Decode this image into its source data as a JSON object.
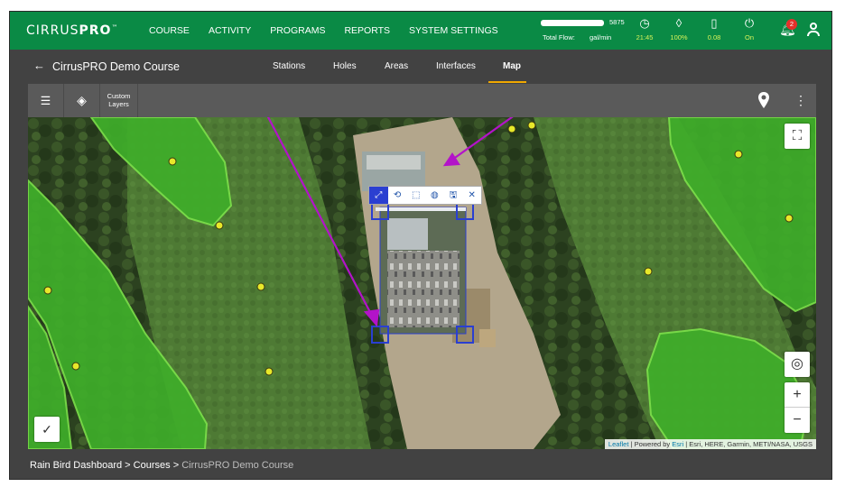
{
  "app": {
    "logo_main": "CIRRUS",
    "logo_pro": "PRO",
    "logo_tm": "™"
  },
  "nav": [
    "COURSE",
    "ACTIVITY",
    "PROGRAMS",
    "REPORTS",
    "SYSTEM SETTINGS"
  ],
  "flow": {
    "label": "Total Flow:",
    "value": "5875",
    "unit": "gal/min"
  },
  "stats": [
    {
      "icon": "clock-icon",
      "glyph": "◷",
      "value": "21:45"
    },
    {
      "icon": "water-drop-icon",
      "glyph": "◊",
      "value": "100%"
    },
    {
      "icon": "gauge-icon",
      "glyph": "▯",
      "value": "0.08"
    },
    {
      "icon": "power-icon",
      "glyph": "⏻",
      "value": "On"
    }
  ],
  "notifications": {
    "count": "2"
  },
  "subheader": {
    "back": "←",
    "course_title": "CirrusPRO Demo Course",
    "tabs": [
      "Stations",
      "Holes",
      "Areas",
      "Interfaces",
      "Map"
    ],
    "active_tab": "Map"
  },
  "toolbar": {
    "list_icon": "☰",
    "layers_icon": "◈",
    "custom_layers": [
      "Custom",
      "Layers"
    ],
    "more": "⋮"
  },
  "map": {
    "attribution_link": "Leaflet",
    "attribution_text": " | Powered by ",
    "attribution_esri": "Esri",
    "attribution_rest": " | Esri, HERE, Garmin, METI/NASA, USGS",
    "zoom_in": "+",
    "zoom_out": "−",
    "fullscreen": "⛶",
    "locate": "◎",
    "edit_tools": [
      "⤢",
      "⟲",
      "⬚",
      "◍",
      "🖫",
      "✕"
    ]
  },
  "breadcrumb": {
    "dashboard": "Rain Bird Dashboard",
    "sep": " > ",
    "courses": "Courses",
    "current": "CirrusPRO Demo Course"
  },
  "colors": {
    "brand": "#0a8a45",
    "accent": "#f0a800",
    "fairway": "#3fae2a",
    "head": "#e8e82a",
    "annotation": "#b313c9"
  }
}
